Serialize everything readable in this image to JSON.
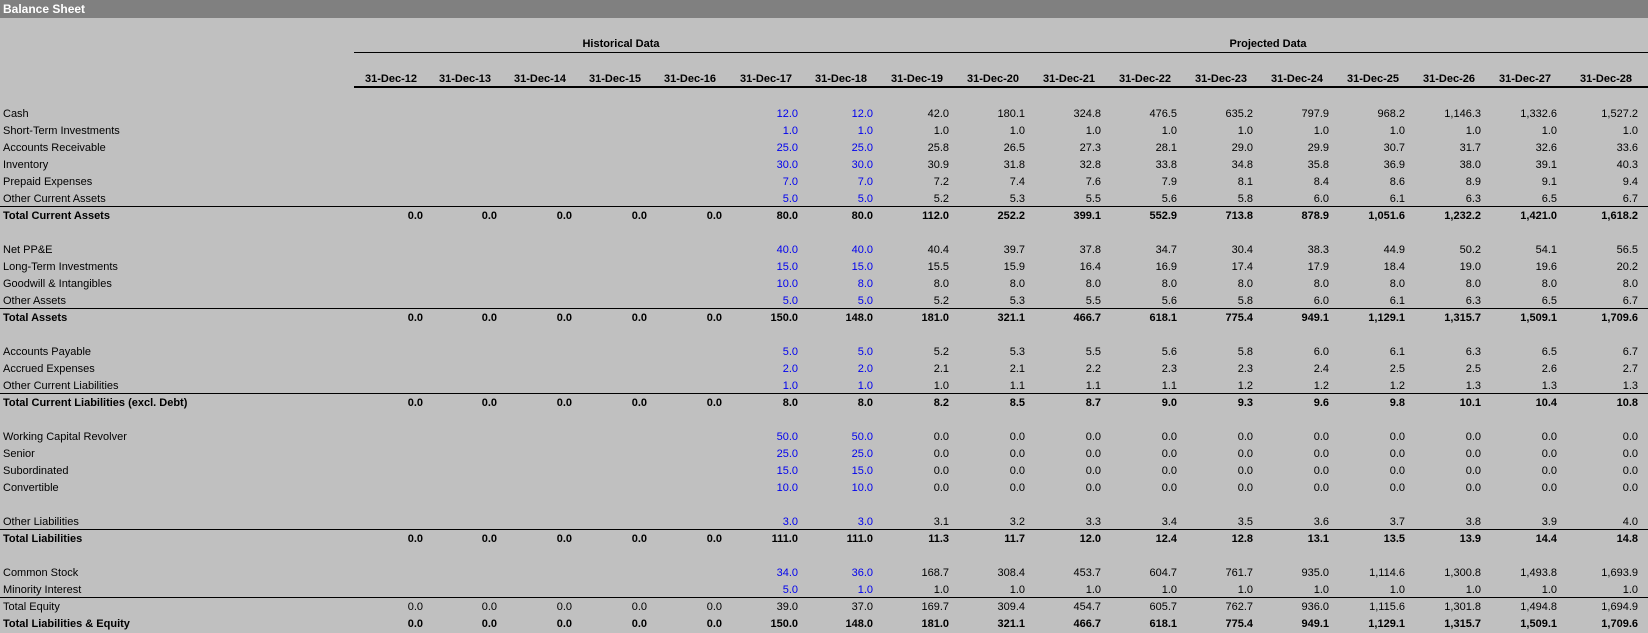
{
  "title": "Balance Sheet",
  "groups": {
    "historical": "Historical Data",
    "projected": "Projected Data"
  },
  "dates": [
    "31-Dec-12",
    "31-Dec-13",
    "31-Dec-14",
    "31-Dec-15",
    "31-Dec-16",
    "31-Dec-17",
    "31-Dec-18",
    "31-Dec-19",
    "31-Dec-20",
    "31-Dec-21",
    "31-Dec-22",
    "31-Dec-23",
    "31-Dec-24",
    "31-Dec-25",
    "31-Dec-26",
    "31-Dec-27",
    "31-Dec-28"
  ],
  "colors": {
    "input": "#0000ee",
    "background": "#c0c0c0",
    "titlebar": "#808080"
  },
  "rows": [
    {
      "label": "Cash",
      "values": [
        "",
        "",
        "",
        "",
        "",
        "12.0",
        "12.0",
        "42.0",
        "180.1",
        "324.8",
        "476.5",
        "635.2",
        "797.9",
        "968.2",
        "1,146.3",
        "1,332.6",
        "1,527.2"
      ]
    },
    {
      "label": "Short-Term Investments",
      "values": [
        "",
        "",
        "",
        "",
        "",
        "1.0",
        "1.0",
        "1.0",
        "1.0",
        "1.0",
        "1.0",
        "1.0",
        "1.0",
        "1.0",
        "1.0",
        "1.0",
        "1.0"
      ]
    },
    {
      "label": "Accounts Receivable",
      "values": [
        "",
        "",
        "",
        "",
        "",
        "25.0",
        "25.0",
        "25.8",
        "26.5",
        "27.3",
        "28.1",
        "29.0",
        "29.9",
        "30.7",
        "31.7",
        "32.6",
        "33.6"
      ]
    },
    {
      "label": "Inventory",
      "values": [
        "",
        "",
        "",
        "",
        "",
        "30.0",
        "30.0",
        "30.9",
        "31.8",
        "32.8",
        "33.8",
        "34.8",
        "35.8",
        "36.9",
        "38.0",
        "39.1",
        "40.3"
      ]
    },
    {
      "label": "Prepaid Expenses",
      "values": [
        "",
        "",
        "",
        "",
        "",
        "7.0",
        "7.0",
        "7.2",
        "7.4",
        "7.6",
        "7.9",
        "8.1",
        "8.4",
        "8.6",
        "8.9",
        "9.1",
        "9.4"
      ]
    },
    {
      "label": "Other Current Assets",
      "values": [
        "",
        "",
        "",
        "",
        "",
        "5.0",
        "5.0",
        "5.2",
        "5.3",
        "5.5",
        "5.6",
        "5.8",
        "6.0",
        "6.1",
        "6.3",
        "6.5",
        "6.7"
      ]
    },
    {
      "label": "Total Current Assets",
      "bold": true,
      "values": [
        "0.0",
        "0.0",
        "0.0",
        "0.0",
        "0.0",
        "80.0",
        "80.0",
        "112.0",
        "252.2",
        "399.1",
        "552.9",
        "713.8",
        "878.9",
        "1,051.6",
        "1,232.2",
        "1,421.0",
        "1,618.2"
      ]
    },
    {
      "label": "Net PP&E",
      "values": [
        "",
        "",
        "",
        "",
        "",
        "40.0",
        "40.0",
        "40.4",
        "39.7",
        "37.8",
        "34.7",
        "30.4",
        "38.3",
        "44.9",
        "50.2",
        "54.1",
        "56.5"
      ]
    },
    {
      "label": "Long-Term Investments",
      "values": [
        "",
        "",
        "",
        "",
        "",
        "15.0",
        "15.0",
        "15.5",
        "15.9",
        "16.4",
        "16.9",
        "17.4",
        "17.9",
        "18.4",
        "19.0",
        "19.6",
        "20.2"
      ]
    },
    {
      "label": "Goodwill & Intangibles",
      "values": [
        "",
        "",
        "",
        "",
        "",
        "10.0",
        "8.0",
        "8.0",
        "8.0",
        "8.0",
        "8.0",
        "8.0",
        "8.0",
        "8.0",
        "8.0",
        "8.0",
        "8.0"
      ]
    },
    {
      "label": "Other Assets",
      "values": [
        "",
        "",
        "",
        "",
        "",
        "5.0",
        "5.0",
        "5.2",
        "5.3",
        "5.5",
        "5.6",
        "5.8",
        "6.0",
        "6.1",
        "6.3",
        "6.5",
        "6.7"
      ]
    },
    {
      "label": "Total Assets",
      "bold": true,
      "values": [
        "0.0",
        "0.0",
        "0.0",
        "0.0",
        "0.0",
        "150.0",
        "148.0",
        "181.0",
        "321.1",
        "466.7",
        "618.1",
        "775.4",
        "949.1",
        "1,129.1",
        "1,315.7",
        "1,509.1",
        "1,709.6"
      ]
    },
    {
      "label": "Accounts Payable",
      "values": [
        "",
        "",
        "",
        "",
        "",
        "5.0",
        "5.0",
        "5.2",
        "5.3",
        "5.5",
        "5.6",
        "5.8",
        "6.0",
        "6.1",
        "6.3",
        "6.5",
        "6.7"
      ]
    },
    {
      "label": "Accrued Expenses",
      "values": [
        "",
        "",
        "",
        "",
        "",
        "2.0",
        "2.0",
        "2.1",
        "2.1",
        "2.2",
        "2.3",
        "2.3",
        "2.4",
        "2.5",
        "2.5",
        "2.6",
        "2.7"
      ]
    },
    {
      "label": "Other Current Liabilities",
      "values": [
        "",
        "",
        "",
        "",
        "",
        "1.0",
        "1.0",
        "1.0",
        "1.1",
        "1.1",
        "1.1",
        "1.2",
        "1.2",
        "1.2",
        "1.3",
        "1.3",
        "1.3"
      ]
    },
    {
      "label": "Total Current Liabilities (excl. Debt)",
      "bold": true,
      "values": [
        "0.0",
        "0.0",
        "0.0",
        "0.0",
        "0.0",
        "8.0",
        "8.0",
        "8.2",
        "8.5",
        "8.7",
        "9.0",
        "9.3",
        "9.6",
        "9.8",
        "10.1",
        "10.4",
        "10.8"
      ]
    },
    {
      "label": "Working Capital Revolver",
      "values": [
        "",
        "",
        "",
        "",
        "",
        "50.0",
        "50.0",
        "0.0",
        "0.0",
        "0.0",
        "0.0",
        "0.0",
        "0.0",
        "0.0",
        "0.0",
        "0.0",
        "0.0"
      ]
    },
    {
      "label": "Senior",
      "values": [
        "",
        "",
        "",
        "",
        "",
        "25.0",
        "25.0",
        "0.0",
        "0.0",
        "0.0",
        "0.0",
        "0.0",
        "0.0",
        "0.0",
        "0.0",
        "0.0",
        "0.0"
      ]
    },
    {
      "label": "Subordinated",
      "values": [
        "",
        "",
        "",
        "",
        "",
        "15.0",
        "15.0",
        "0.0",
        "0.0",
        "0.0",
        "0.0",
        "0.0",
        "0.0",
        "0.0",
        "0.0",
        "0.0",
        "0.0"
      ]
    },
    {
      "label": "Convertible",
      "values": [
        "",
        "",
        "",
        "",
        "",
        "10.0",
        "10.0",
        "0.0",
        "0.0",
        "0.0",
        "0.0",
        "0.0",
        "0.0",
        "0.0",
        "0.0",
        "0.0",
        "0.0"
      ]
    },
    {
      "label": "Other Liabilities",
      "values": [
        "",
        "",
        "",
        "",
        "",
        "3.0",
        "3.0",
        "3.1",
        "3.2",
        "3.3",
        "3.4",
        "3.5",
        "3.6",
        "3.7",
        "3.8",
        "3.9",
        "4.0"
      ]
    },
    {
      "label": "Total Liabilities",
      "bold": true,
      "values": [
        "0.0",
        "0.0",
        "0.0",
        "0.0",
        "0.0",
        "111.0",
        "111.0",
        "11.3",
        "11.7",
        "12.0",
        "12.4",
        "12.8",
        "13.1",
        "13.5",
        "13.9",
        "14.4",
        "14.8"
      ]
    },
    {
      "label": "Common Stock",
      "values": [
        "",
        "",
        "",
        "",
        "",
        "34.0",
        "36.0",
        "168.7",
        "308.4",
        "453.7",
        "604.7",
        "761.7",
        "935.0",
        "1,114.6",
        "1,300.8",
        "1,493.8",
        "1,693.9"
      ]
    },
    {
      "label": "Minority Interest",
      "values": [
        "",
        "",
        "",
        "",
        "",
        "5.0",
        "1.0",
        "1.0",
        "1.0",
        "1.0",
        "1.0",
        "1.0",
        "1.0",
        "1.0",
        "1.0",
        "1.0",
        "1.0"
      ]
    },
    {
      "label": "Total Equity",
      "values": [
        "0.0",
        "0.0",
        "0.0",
        "0.0",
        "0.0",
        "39.0",
        "37.0",
        "169.7",
        "309.4",
        "454.7",
        "605.7",
        "762.7",
        "936.0",
        "1,115.6",
        "1,301.8",
        "1,494.8",
        "1,694.9"
      ]
    },
    {
      "label": "Total Liabilities & Equity",
      "bold": true,
      "values": [
        "0.0",
        "0.0",
        "0.0",
        "0.0",
        "0.0",
        "150.0",
        "148.0",
        "181.0",
        "321.1",
        "466.7",
        "618.1",
        "775.4",
        "949.1",
        "1,129.1",
        "1,315.7",
        "1,509.1",
        "1,709.6"
      ]
    }
  ]
}
